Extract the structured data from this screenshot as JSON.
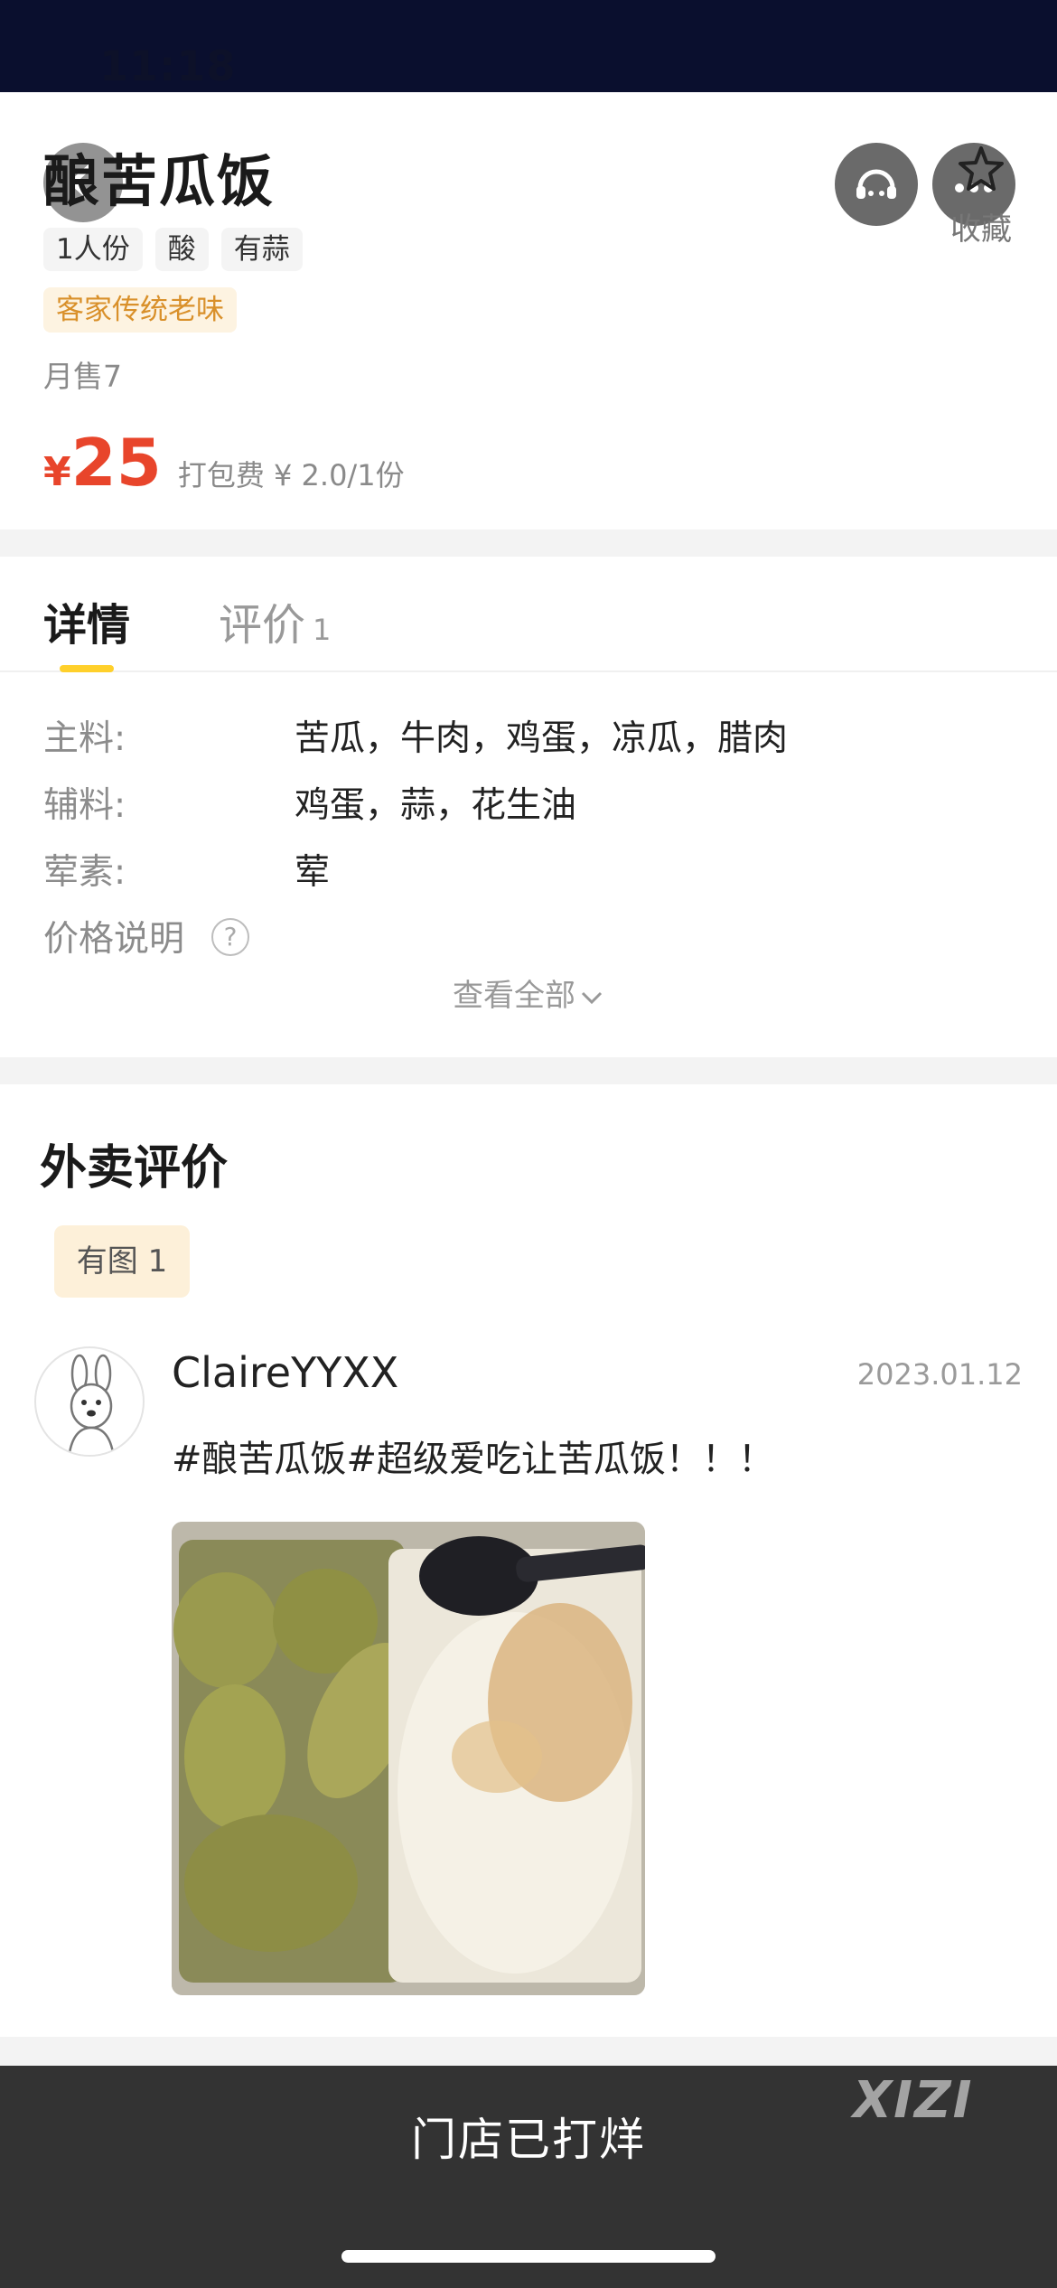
{
  "status": {
    "time": "11:18"
  },
  "dish": {
    "title": "酿苦瓜饭",
    "tags": [
      "1人份",
      "酸",
      "有蒜"
    ],
    "flavor_tag": "客家传统老味",
    "monthly_sales": "月售7",
    "currency": "¥",
    "price": "25",
    "packing_fee": "打包费 ¥ 2.0/1份",
    "favorite_label": "收藏"
  },
  "tabs": [
    {
      "label": "详情"
    },
    {
      "label": "评价",
      "count": "1"
    }
  ],
  "details": {
    "rows": [
      {
        "label": "主料:",
        "value": "苦瓜，牛肉，鸡蛋，凉瓜，腊肉"
      },
      {
        "label": "辅料:",
        "value": "鸡蛋，蒜，花生油"
      },
      {
        "label": "荤素:",
        "value": "荤"
      }
    ],
    "price_note_label": "价格说明",
    "help_glyph": "?",
    "view_all": "查看全部"
  },
  "reviews": {
    "section_title": "外卖评价",
    "filter_chip": "有图 1",
    "items": [
      {
        "username": "ClaireYYXX",
        "date": "2023.01.12",
        "text": "#酿苦瓜饭#超级爱吃让苦瓜饭！！！"
      }
    ]
  },
  "footer": {
    "status_text": "门店已打烊",
    "watermark": "XIZI"
  },
  "colors": {
    "price_red": "#e8452b",
    "tab_underline_yellow": "#ffd02b",
    "flavor_tag_orange": "#d9902a",
    "bottom_bar": "#333333"
  },
  "icons": [
    "back-arrow-icon",
    "customer-service-icon",
    "more-icon",
    "star-icon",
    "help-icon",
    "chevron-down-icon"
  ]
}
